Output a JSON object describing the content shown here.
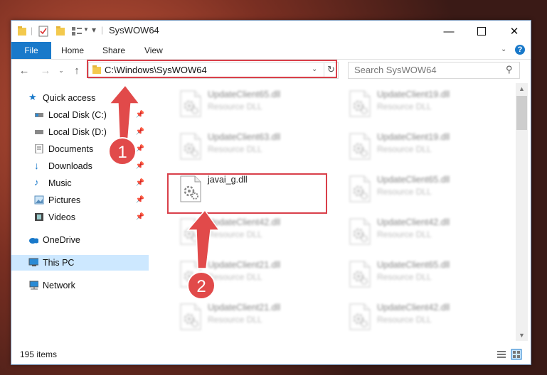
{
  "window": {
    "title": "SysWOW64"
  },
  "ribbon": {
    "tabs": [
      "File",
      "Home",
      "Share",
      "View"
    ]
  },
  "address": {
    "path": "C:\\Windows\\SysWOW64"
  },
  "search": {
    "placeholder": "Search SysWOW64"
  },
  "nav": {
    "quick_access": "Quick access",
    "items": [
      "Local Disk (C:)",
      "Local Disk (D:)",
      "Documents",
      "Downloads",
      "Music",
      "Pictures",
      "Videos"
    ],
    "onedrive": "OneDrive",
    "this_pc": "This PC",
    "network": "Network"
  },
  "files": {
    "left": [
      {
        "name": "UpdateClient65.dll",
        "type": "Resource DLL"
      },
      {
        "name": "UpdateClient63.dll",
        "type": "Resource DLL"
      },
      {
        "name": "javai_g.dll",
        "type": ""
      },
      {
        "name": "UpdateClient42.dll",
        "type": "Resource DLL"
      },
      {
        "name": "UpdateClient21.dll",
        "type": "Resource DLL"
      },
      {
        "name": "UpdateClient21.dll",
        "type": "Resource DLL"
      }
    ],
    "right": [
      {
        "name": "UpdateClient19.dll",
        "type": "Resource DLL"
      },
      {
        "name": "UpdateClient19.dll",
        "type": "Resource DLL"
      },
      {
        "name": "UpdateClient65.dll",
        "type": "Resource DLL"
      },
      {
        "name": "UpdateClient42.dll",
        "type": "Resource DLL"
      },
      {
        "name": "UpdateClient65.dll",
        "type": "Resource DLL"
      },
      {
        "name": "UpdateClient42.dll",
        "type": "Resource DLL"
      }
    ]
  },
  "status": {
    "count": "195 items"
  },
  "annotations": {
    "step1": "1",
    "step2": "2"
  },
  "colors": {
    "accent": "#1979ca",
    "highlight": "#d9404a"
  }
}
